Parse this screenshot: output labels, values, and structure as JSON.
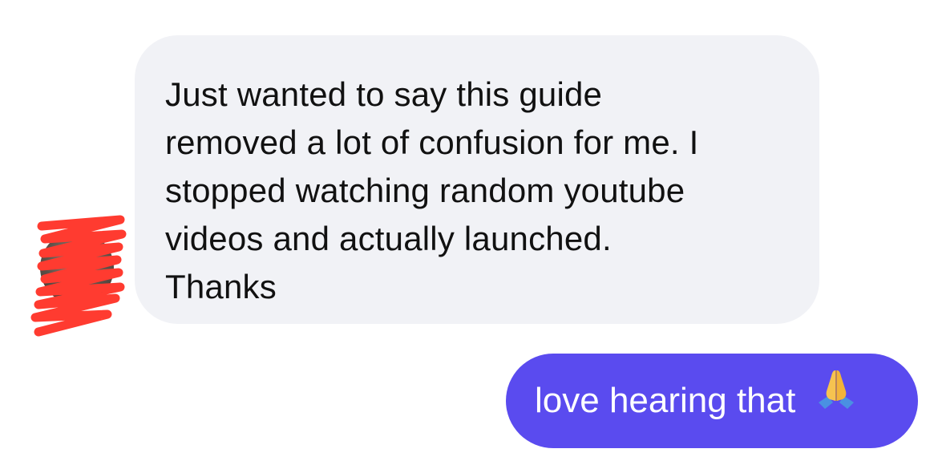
{
  "conversation": {
    "incoming": {
      "text": "Just wanted to say this guide\nremoved a lot of confusion for me. I\nstopped watching random youtube\nvideos and actually launched.\nThanks"
    },
    "outgoing": {
      "text": "love hearing that",
      "emoji": "folded-hands-icon"
    }
  },
  "colors": {
    "incoming_bubble": "#f1f2f6",
    "outgoing_bubble": "#5a4bef",
    "scribble": "#ff3b30"
  }
}
